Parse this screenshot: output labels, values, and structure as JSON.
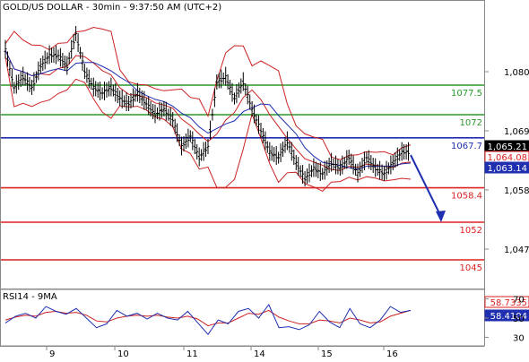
{
  "header": {
    "title": "GOLD/US DOLLAR - 30min - 9:37:50 AM (UTC+2)"
  },
  "chart_data": [
    {
      "type": "candlestick",
      "title": "GOLD/US DOLLAR - 30min - 9:37:50 AM (UTC+2)",
      "ylim": [
        1040,
        1093
      ],
      "y_ticks": [
        1047,
        1058,
        1069,
        1080
      ],
      "y_tick_labels": [
        "1,047",
        "1,058",
        "1,069",
        "1,080"
      ],
      "x_tick_labels": [
        "9",
        "10",
        "11",
        "14",
        "15",
        "16"
      ],
      "grid": false,
      "levels": [
        {
          "label": "1077.5",
          "value": 1077.5,
          "color": "#2a9a2a"
        },
        {
          "label": "1072",
          "value": 1072,
          "color": "#2a9a2a"
        },
        {
          "label": "1067.7",
          "value": 1067.7,
          "color": "#1f2fb0"
        },
        {
          "label": "1058.4",
          "value": 1058.4,
          "color": "#dd2222"
        },
        {
          "label": "1052",
          "value": 1052,
          "color": "#dd2222"
        },
        {
          "label": "1045",
          "value": 1045,
          "color": "#dd2222"
        }
      ],
      "price_tags": [
        {
          "label": "1,065.21",
          "value": 1065.21,
          "bg": "#000000",
          "fg": "#ffffff"
        },
        {
          "label": "1,064.08",
          "value": 1064.08,
          "bg": "#ffffff",
          "fg": "#dd2222"
        },
        {
          "label": "1,063.14",
          "value": 1063.14,
          "bg": "#1f2fb0",
          "fg": "#ffffff"
        }
      ],
      "forecast_arrow": {
        "from_value": 1064.5,
        "to_value": 1052,
        "color": "#1f2fb0"
      },
      "price_path": [
        1084,
        1077,
        1079,
        1077,
        1081,
        1083,
        1083,
        1081,
        1087,
        1080,
        1077,
        1076,
        1077,
        1075,
        1074,
        1076,
        1074,
        1072,
        1073,
        1071,
        1066,
        1068,
        1064,
        1066,
        1078,
        1079,
        1075,
        1078,
        1073,
        1069,
        1065,
        1064,
        1067,
        1063,
        1060,
        1062,
        1061,
        1063,
        1062,
        1064,
        1061,
        1064,
        1062,
        1061,
        1063,
        1065,
        1065
      ]
    },
    {
      "type": "line",
      "title": "RSI14 - 9MA",
      "ylim": [
        22,
        78
      ],
      "y_ticks": [
        30,
        50,
        70
      ],
      "y_tick_labels": [
        "30",
        "50",
        "70"
      ],
      "value_tags": [
        {
          "label": "58.7335",
          "value": 58.7335,
          "bg": "#ffffff",
          "fg": "#dd2222"
        },
        {
          "label": "58.4104",
          "value": 58.4104,
          "bg": "#1f2fb0",
          "fg": "#ffffff"
        }
      ],
      "rsi_path": [
        45,
        52,
        55,
        50,
        62,
        57,
        54,
        60,
        50,
        40,
        44,
        58,
        52,
        55,
        49,
        55,
        50,
        48,
        57,
        45,
        33,
        48,
        44,
        57,
        60,
        50,
        64,
        40,
        41,
        38,
        43,
        57,
        46,
        40,
        60,
        44,
        40,
        48,
        62,
        56,
        58
      ],
      "ma_path": [
        48,
        51,
        53,
        52,
        56,
        57,
        55,
        56,
        53,
        47,
        46,
        50,
        52,
        53,
        52,
        53,
        51,
        50,
        52,
        49,
        42,
        45,
        45,
        50,
        55,
        54,
        58,
        51,
        47,
        44,
        44,
        48,
        47,
        45,
        50,
        48,
        45,
        46,
        52,
        55,
        58
      ]
    }
  ]
}
